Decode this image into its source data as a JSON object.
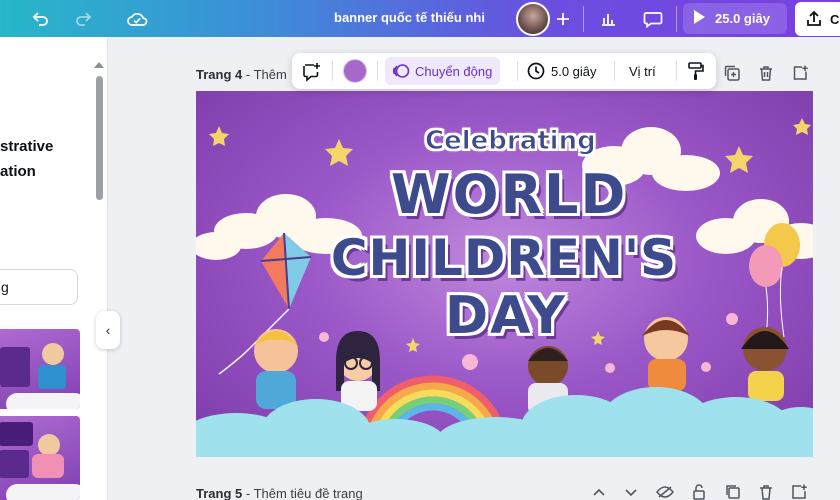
{
  "topbar": {
    "doc_title": "banner quốc tế thiếu nhi",
    "play_duration": "25.0 giây",
    "share_label": "C"
  },
  "left_panel": {
    "line1": "strative",
    "line2": "ation",
    "field_text": "g",
    "collapse_glyph": "‹"
  },
  "page4": {
    "label": "Trang 4",
    "sub": " - Thêm"
  },
  "context_toolbar": {
    "animate_label": "Chuyển động",
    "duration_label": "5.0 giây",
    "position_label": "Vị trí",
    "color": "#a668c9"
  },
  "design": {
    "celebrating": "Celebrating",
    "line1": "WORLD",
    "line2": "CHILDREN'S",
    "line3": "DAY"
  },
  "page5": {
    "label": "Trang 5",
    "sub": " - Thêm tiêu đề trang"
  },
  "colors": {
    "accent": "#7b3fe0",
    "title_text": "#3d4a8c",
    "canvas_bg": "#9b58c8"
  }
}
